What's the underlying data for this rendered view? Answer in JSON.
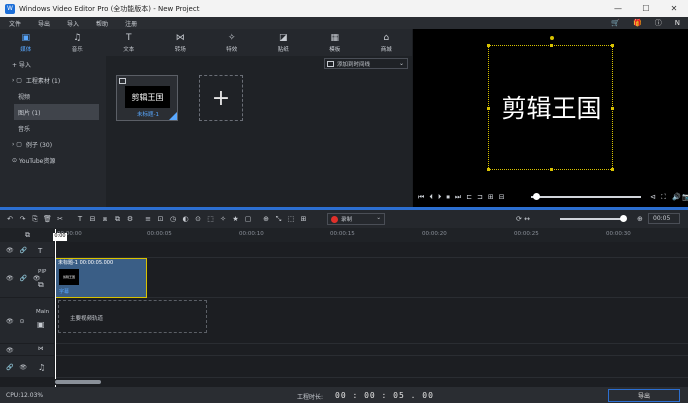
{
  "window": {
    "title": "Windows Video Editor Pro (全功能版本) - New Project",
    "app_icon": "W",
    "minimize": "—",
    "maximize": "☐",
    "close": "✕"
  },
  "menu": {
    "items": [
      "文件",
      "导出",
      "导入",
      "帮助",
      "注册"
    ],
    "right_icons": [
      "cart-icon",
      "gift-icon",
      "info-icon",
      "user-icon"
    ],
    "right_glyphs": [
      "🛒",
      "🎁",
      "ⓘ",
      "N"
    ]
  },
  "tabs": [
    {
      "icon": "media-icon",
      "glyph": "▣",
      "label": "媒体",
      "active": true
    },
    {
      "icon": "music-icon",
      "glyph": "♫",
      "label": "音乐",
      "active": false
    },
    {
      "icon": "text-icon",
      "glyph": "T",
      "label": "文本",
      "active": false
    },
    {
      "icon": "transition-icon",
      "glyph": "⋈",
      "label": "转场",
      "active": false
    },
    {
      "icon": "effect-icon",
      "glyph": "✧",
      "label": "特效",
      "active": false
    },
    {
      "icon": "sticker-icon",
      "glyph": "◪",
      "label": "贴纸",
      "active": false
    },
    {
      "icon": "template-icon",
      "glyph": "▦",
      "label": "模板",
      "active": false
    },
    {
      "icon": "store-icon",
      "glyph": "⌂",
      "label": "商城",
      "active": false
    }
  ],
  "sidebar": {
    "import": "+  导入",
    "items": [
      {
        "label": "工程素材 (1)",
        "prefix": "›  ▢"
      },
      {
        "label": "视频",
        "prefix": ""
      },
      {
        "label": "图片 (1)",
        "prefix": "",
        "selected": true
      },
      {
        "label": "音乐",
        "prefix": ""
      },
      {
        "label": "例子 (30)",
        "prefix": "›  ▢"
      },
      {
        "label": "YouTube资源",
        "prefix": "⊙"
      }
    ]
  },
  "media": {
    "dropdown_label": "添加到时间线",
    "thumb_text": "剪辑王国",
    "thumb_caption": "未标题-1",
    "add_glyph": "+"
  },
  "preview": {
    "text": "剪辑王国",
    "controls": [
      "⏮",
      "⏴",
      "⏵",
      "⏹",
      "⏭",
      "⊏",
      "⊐",
      "⊞",
      "⊟"
    ],
    "right_controls": [
      "⊲",
      "⛶",
      "🔊",
      "📷"
    ],
    "progress": 0
  },
  "toolbar": {
    "icons": [
      "↶",
      "↷",
      "⎘",
      "🗑",
      "✂",
      "T",
      "⊟",
      "⧈",
      "⧉",
      "⚙",
      "≡",
      "⊡",
      "◷",
      "◐",
      "⊙",
      "⬚",
      "✧",
      "★",
      "▢",
      "⊕",
      "⤡",
      "⬚",
      "⊞"
    ],
    "record_label": "录制",
    "zoom_label": "⟳  ↔",
    "zoom_level": 0.95,
    "time_label": "00:05"
  },
  "ruler": {
    "labels": [
      "00:00:00",
      "00:00:05",
      "00:00:10",
      "00:00:15",
      "00:00:20",
      "00:00:25",
      "00:00:30"
    ],
    "playhead": "0:00"
  },
  "tracks": {
    "text_icon": "T",
    "pip_name": "PIP",
    "main_name": "Main",
    "main_hint": "主要视频轨道",
    "clip_header": "未标题-1   00:00:05.000",
    "clip_thumb_text": "剪辑王国",
    "clip_caption": "字幕"
  },
  "status": {
    "cpu": "CPU:12.03%",
    "duration_label": "工程时长:",
    "duration_value": "00 : 00 : 05 . 00",
    "export_label": "导出"
  }
}
